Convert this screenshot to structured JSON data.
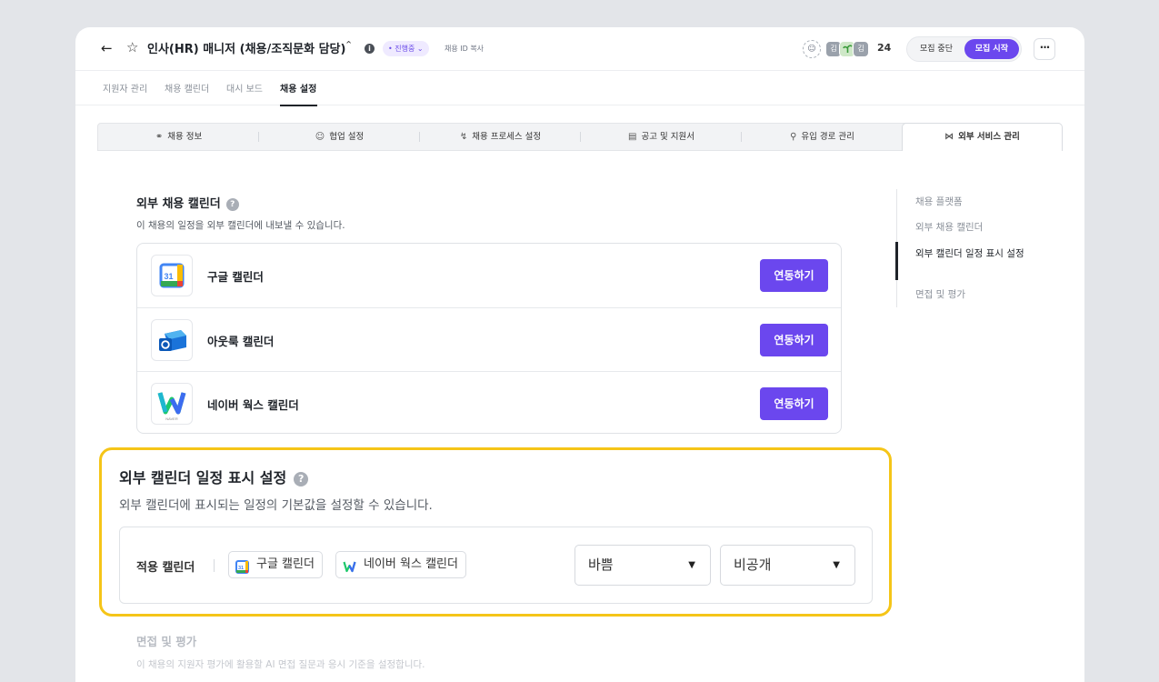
{
  "header": {
    "back_icon": "arrow-left-icon",
    "star_icon": "star-outline-icon",
    "title": "인사(HR) 매니저 (채용/조직문화 담당)",
    "status": "• 진행중",
    "copy_id": "채용 ID 복사",
    "avatars": [
      "김",
      "",
      "김"
    ],
    "member_count": "24",
    "stop_label": "모집 중단",
    "start_label": "모집 시작"
  },
  "tabs": [
    "지원자 관리",
    "채용 캘린더",
    "대시 보드",
    "채용 설정"
  ],
  "section_tabs": [
    {
      "icon": "globe-icon",
      "label": "채용 정보"
    },
    {
      "icon": "people-icon",
      "label": "협업 설정"
    },
    {
      "icon": "lightning-icon",
      "label": "채용 프로세스 설정"
    },
    {
      "icon": "document-icon",
      "label": "공고 및 지원서"
    },
    {
      "icon": "flow-icon",
      "label": "유입 경로 관리"
    },
    {
      "icon": "share-icon",
      "label": "외부 서비스 관리"
    }
  ],
  "external_calendar": {
    "title": "외부 채용 캘린더",
    "description": "이 채용의 일정을 외부 캘린더에 내보낼 수 있습니다.",
    "items": [
      {
        "name": "구글 캘린더",
        "button": "연동하기",
        "logo": "google-calendar-icon"
      },
      {
        "name": "아웃룩 캘린더",
        "button": "연동하기",
        "logo": "outlook-icon"
      },
      {
        "name": "네이버 웍스 캘린더",
        "button": "연동하기",
        "logo": "naver-works-icon"
      }
    ]
  },
  "display_settings": {
    "title": "외부 캘린더 일정 표시 설정",
    "description": "외부 캘린더에 표시되는 일정의 기본값을 설정할 수 있습니다.",
    "apply_label": "적용 캘린더",
    "chips": [
      "구글 캘린더",
      "네이버 웍스 캘린더"
    ],
    "busy_value": "바쁨",
    "visibility_value": "비공개"
  },
  "interview": {
    "title": "면접 및 평가",
    "description": "이 채용의 지원자 평가에 활용할 AI 면접 질문과 응시 기준을 설정합니다."
  },
  "side_nav": [
    "채용 플랫폼",
    "외부 채용 캘린더",
    "외부 캘린더 일정 표시 설정",
    "면접 및 평가"
  ],
  "colors": {
    "accent": "#6b47ee",
    "highlight": "#f5c518"
  }
}
